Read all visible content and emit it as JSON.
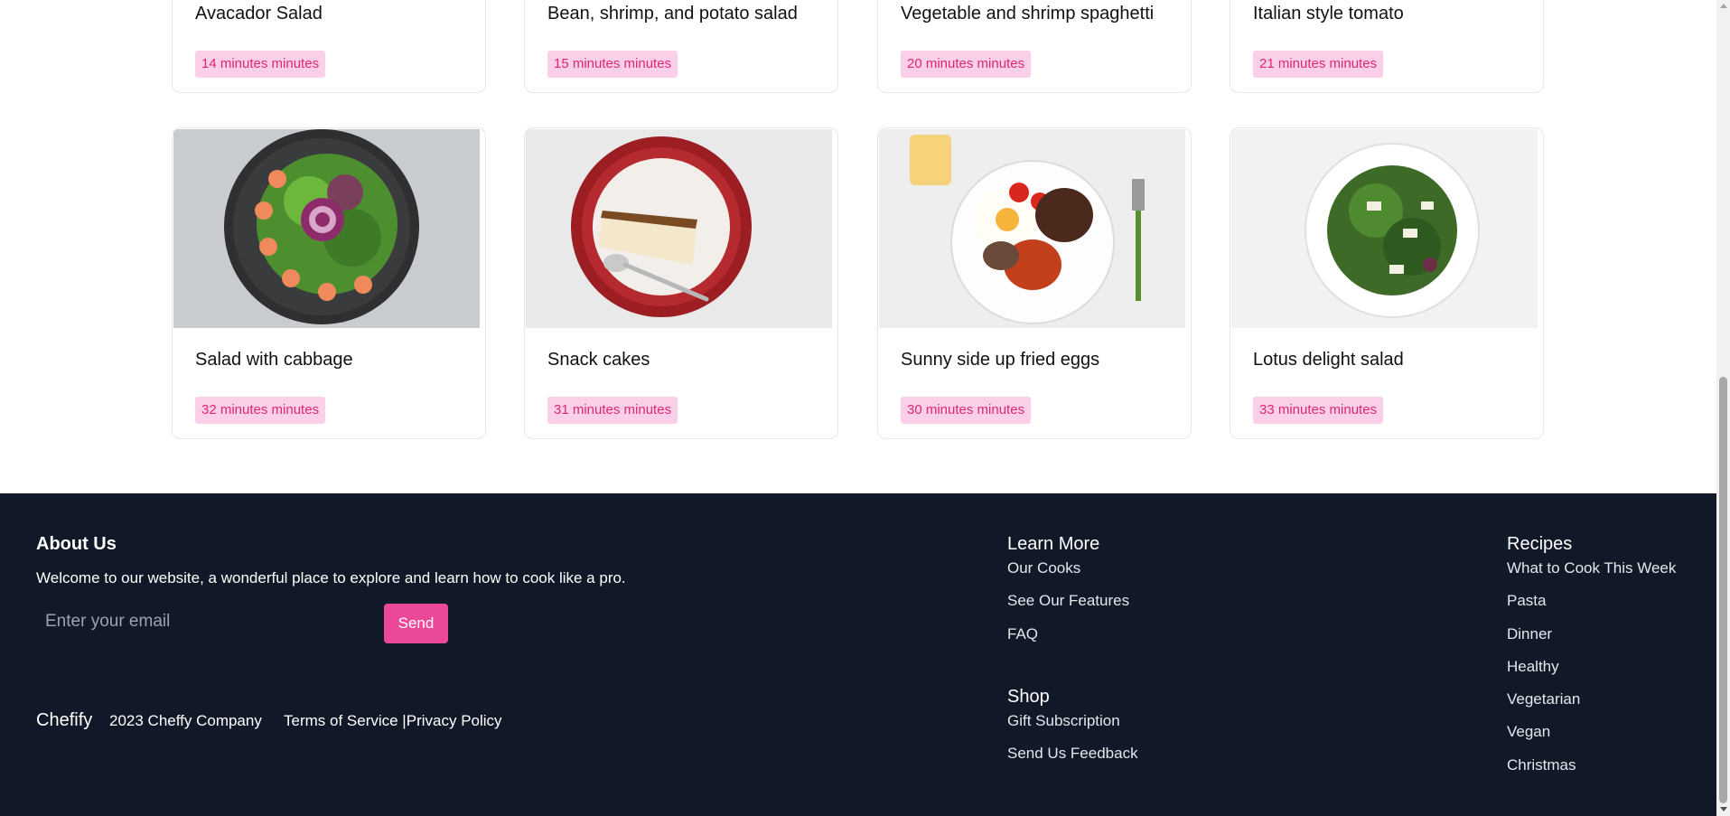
{
  "recipes_row1": [
    {
      "title": "Avacador Salad",
      "time": "14 minutes minutes"
    },
    {
      "title": "Bean, shrimp, and potato salad",
      "time": "15 minutes minutes"
    },
    {
      "title": "Vegetable and shrimp spaghetti",
      "time": "20 minutes minutes"
    },
    {
      "title": "Italian style tomato",
      "time": "21 minutes minutes"
    }
  ],
  "recipes_row2": [
    {
      "title": "Salad with cabbage",
      "time": "32 minutes minutes",
      "image": "shrimp-salad-bowl"
    },
    {
      "title": "Snack cakes",
      "time": "31 minutes minutes",
      "image": "cake-slice-plate"
    },
    {
      "title": "Sunny side up fried eggs",
      "time": "30 minutes minutes",
      "image": "fried-eggs-breakfast"
    },
    {
      "title": "Lotus delight salad",
      "time": "33 minutes minutes",
      "image": "green-salad-plate"
    }
  ],
  "footer": {
    "about_title": "About Us",
    "about_text": "Welcome to our website, a wonderful place to explore and learn how to cook like a pro.",
    "email_placeholder": "Enter your email",
    "send_label": "Send",
    "brand": "Chefify",
    "copyright": "2023 Cheffy Company",
    "terms": "Terms of Service |",
    "privacy": "Privacy Policy",
    "learn_more": {
      "title": "Learn More",
      "links": [
        "Our Cooks",
        "See Our Features",
        "FAQ"
      ]
    },
    "shop": {
      "title": "Shop",
      "links": [
        "Gift Subscription",
        "Send Us Feedback"
      ]
    },
    "recipes": {
      "title": "Recipes",
      "links": [
        "What to Cook This Week",
        "Pasta",
        "Dinner",
        "Healthy",
        "Vegetarian",
        "Vegan",
        "Christmas"
      ]
    }
  },
  "colors": {
    "badge_bg": "#fbcfe8",
    "badge_text": "#db2777",
    "footer_bg": "#111827",
    "accent": "#ec4899"
  }
}
